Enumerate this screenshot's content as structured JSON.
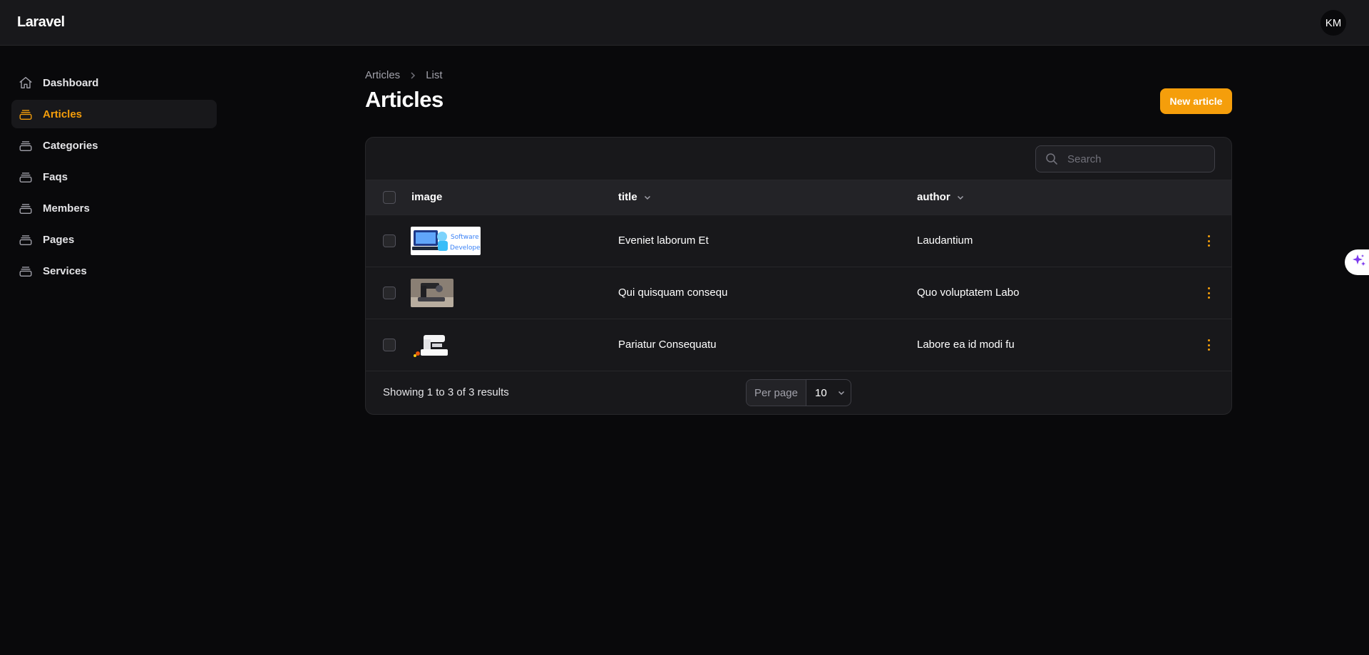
{
  "app": {
    "brand": "Laravel",
    "user_initials": "KM"
  },
  "sidebar": {
    "items": [
      {
        "label": "Dashboard",
        "icon": "home-icon",
        "active": false
      },
      {
        "label": "Articles",
        "icon": "stack-icon",
        "active": true
      },
      {
        "label": "Categories",
        "icon": "stack-icon",
        "active": false
      },
      {
        "label": "Faqs",
        "icon": "stack-icon",
        "active": false
      },
      {
        "label": "Members",
        "icon": "stack-icon",
        "active": false
      },
      {
        "label": "Pages",
        "icon": "stack-icon",
        "active": false
      },
      {
        "label": "Services",
        "icon": "stack-icon",
        "active": false
      }
    ]
  },
  "breadcrumb": {
    "parent": "Articles",
    "current": "List"
  },
  "page": {
    "title": "Articles",
    "new_button": "New article"
  },
  "table": {
    "search_placeholder": "Search",
    "columns": {
      "image": "image",
      "title": "title",
      "author": "author"
    },
    "rows": [
      {
        "image": "software-developer-thumbnail",
        "title": "Eveniet laborum Et",
        "author": "Laudantium"
      },
      {
        "image": "sewing-machine-photo-thumbnail",
        "title": "Qui quisquam consequ",
        "author": "Quo voluptatem Labo"
      },
      {
        "image": "sewing-machine-thumbnail",
        "title": "Pariatur Consequatu",
        "author": "Labore ea id modi fu"
      }
    ],
    "summary": "Showing 1 to 3 of 3 results",
    "per_page_label": "Per page",
    "per_page_value": "10"
  },
  "colors": {
    "accent": "#f59e0b",
    "background": "#09090b",
    "surface": "#18181b",
    "border": "#27272a"
  }
}
